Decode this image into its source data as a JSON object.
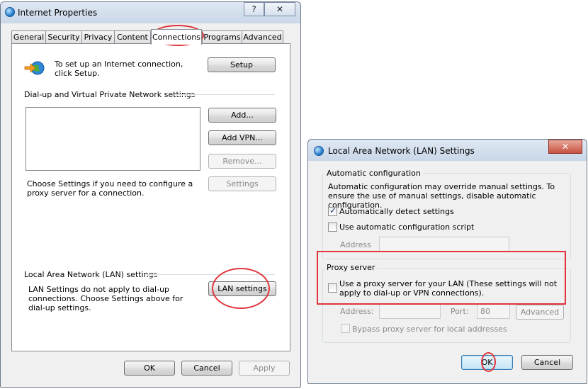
{
  "internet_properties": {
    "title": "Internet Properties",
    "help_glyph": "?",
    "close_glyph": "✕",
    "tabs": [
      "General",
      "Security",
      "Privacy",
      "Content",
      "Connections",
      "Programs",
      "Advanced"
    ],
    "active_tab": "Connections",
    "setup_text": "To set up an Internet connection, click Setup.",
    "setup_button": "Setup",
    "dialup_section": "Dial-up and Virtual Private Network settings",
    "add_button": "Add...",
    "add_vpn_button": "Add VPN...",
    "remove_button": "Remove...",
    "settings_button": "Settings",
    "proxy_text": "Choose Settings if you need to configure a proxy server for a connection.",
    "lan_section": "Local Area Network (LAN) settings",
    "lan_text": "LAN Settings do not apply to dial-up connections. Choose Settings above for dial-up settings.",
    "lan_settings_button": "LAN settings",
    "ok_button": "OK",
    "cancel_button": "Cancel",
    "apply_button": "Apply"
  },
  "lan_dialog": {
    "title": "Local Area Network (LAN) Settings",
    "close_glyph": "✕",
    "auto_config_label": "Automatic configuration",
    "auto_config_text": "Automatic configuration may override manual settings.  To ensure the use of manual settings, disable automatic configuration.",
    "auto_detect_label": "Automatically detect settings",
    "auto_detect_checked": true,
    "use_script_label": "Use automatic configuration script",
    "use_script_checked": false,
    "address_label": "Address",
    "proxy_label": "Proxy server",
    "use_proxy_label": "Use a proxy server for your LAN (These settings will not apply to dial-up or VPN connections).",
    "use_proxy_checked": false,
    "proxy_address_label": "Address:",
    "port_label": "Port:",
    "port_value": "80",
    "advanced_button": "Advanced",
    "bypass_label": "Bypass proxy server for local addresses",
    "ok_button": "OK",
    "cancel_button": "Cancel"
  },
  "colors": {
    "annotation": "#e0353c",
    "window_bg": "#f0f0f0",
    "titlebar": "#dfe8f3"
  }
}
